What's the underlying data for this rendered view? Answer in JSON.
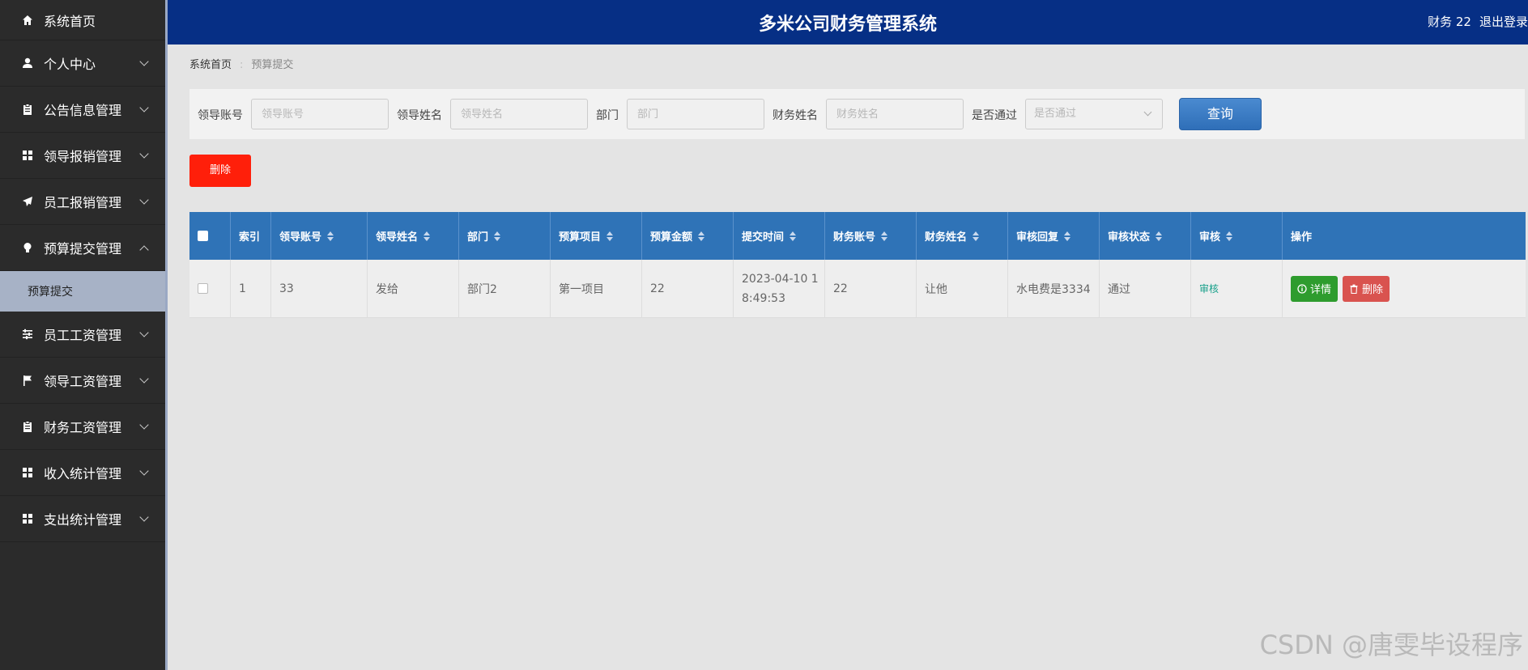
{
  "header": {
    "title": "多米公司财务管理系统",
    "user": "财务 22",
    "logout": "退出登录"
  },
  "sidebar": {
    "items": [
      {
        "label": "系统首页",
        "icon": "home-icon"
      },
      {
        "label": "个人中心",
        "icon": "user-icon"
      },
      {
        "label": "公告信息管理",
        "icon": "clipboard-icon"
      },
      {
        "label": "领导报销管理",
        "icon": "grid-icon"
      },
      {
        "label": "员工报销管理",
        "icon": "paper-plane-icon"
      },
      {
        "label": "预算提交管理",
        "icon": "lightbulb-icon"
      },
      {
        "label": "员工工资管理",
        "icon": "sliders-icon"
      },
      {
        "label": "领导工资管理",
        "icon": "flag-icon"
      },
      {
        "label": "财务工资管理",
        "icon": "clipboard-icon"
      },
      {
        "label": "收入统计管理",
        "icon": "grid-icon"
      },
      {
        "label": "支出统计管理",
        "icon": "grid-icon"
      }
    ],
    "sub_item": "预算提交"
  },
  "breadcrumb": {
    "home": "系统首页",
    "current": "预算提交"
  },
  "search": {
    "fields": [
      {
        "label": "领导账号",
        "placeholder": "领导账号"
      },
      {
        "label": "领导姓名",
        "placeholder": "领导姓名"
      },
      {
        "label": "部门",
        "placeholder": "部门"
      },
      {
        "label": "财务姓名",
        "placeholder": "财务姓名"
      }
    ],
    "select_label": "是否通过",
    "select_placeholder": "是否通过",
    "query_label": "查询"
  },
  "toolbar": {
    "delete_label": "删除"
  },
  "table": {
    "columns": [
      "索引",
      "领导账号",
      "领导姓名",
      "部门",
      "预算项目",
      "预算金额",
      "提交时间",
      "财务账号",
      "财务姓名",
      "审核回复",
      "审核状态",
      "审核",
      "操作"
    ],
    "rows": [
      {
        "index": "1",
        "leader_account": "33",
        "leader_name": "发给",
        "department": "部门2",
        "project": "第一项目",
        "amount": "22",
        "time_line1": "2023-04-10 1",
        "time_line2": "8:49:53",
        "finance_account": "22",
        "finance_name": "让他",
        "reply": "水电费是3334",
        "status": "通过",
        "audit": "审核",
        "detail_label": "详情",
        "delete_label": "删除"
      }
    ]
  },
  "watermark": "CSDN @唐雯毕设程序",
  "colors": {
    "header_bg": "#062f85",
    "sidebar_bg": "#2b2b2b",
    "table_header_bg": "#2f73b7",
    "delete_red": "#ff1f0a",
    "detail_green": "#2e9c2e",
    "row_delete_red": "#d9534f"
  }
}
